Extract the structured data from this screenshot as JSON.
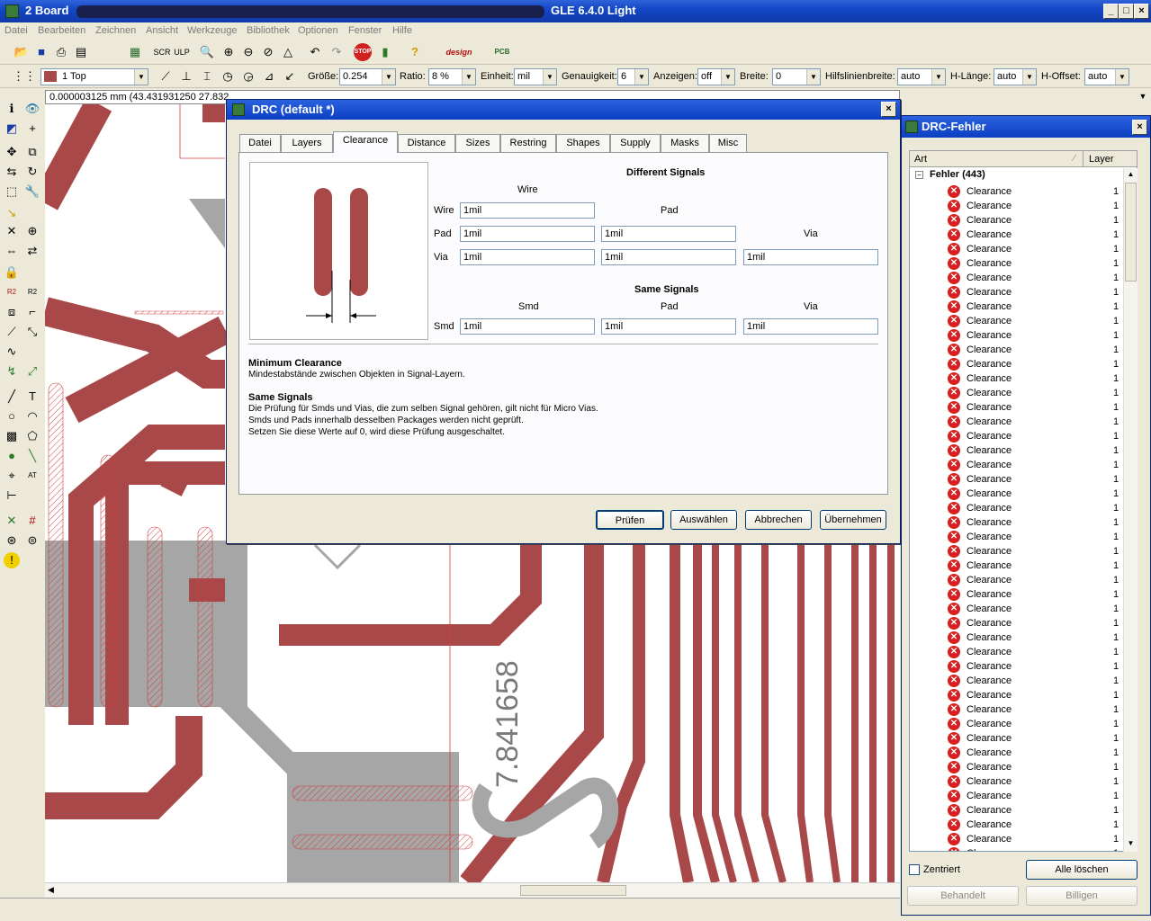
{
  "window": {
    "title": "2 Board",
    "title_suffix": "GLE 6.4.0 Light",
    "min": "_",
    "max": "□",
    "close": "×"
  },
  "menu": [
    "Datei",
    "Bearbeiten",
    "Zeichnen",
    "Ansicht",
    "Werkzeuge",
    "Bibliothek",
    "Optionen",
    "Fenster",
    "Hilfe"
  ],
  "toolbar2": {
    "layer": "1 Top",
    "groesse_label": "Größe:",
    "groesse": "0.254",
    "ratio_label": "Ratio:",
    "ratio": "8 %",
    "einheit_label": "Einheit:",
    "einheit": "mil",
    "genauigkeit_label": "Genauigkeit:",
    "genauigkeit": "6",
    "anzeigen_label": "Anzeigen:",
    "anzeigen": "off",
    "breite_label": "Breite:",
    "breite": "0",
    "hilfsbreite_label": "Hilfslinienbreite:",
    "hilfsbreite": "auto",
    "hlaenge_label": "H-Länge:",
    "hlaenge": "auto",
    "hoffset_label": "H-Offset:",
    "hoffset": "auto"
  },
  "coord": "0.000003125 mm (43.431931250 27.832",
  "canvas_text": "7.841658",
  "drc": {
    "title": "DRC (default *)",
    "close": "×",
    "tabs": [
      "Datei",
      "Layers",
      "Clearance",
      "Distance",
      "Sizes",
      "Restring",
      "Shapes",
      "Supply",
      "Masks",
      "Misc"
    ],
    "active_tab": "Clearance",
    "different_signals": "Different Signals",
    "same_signals": "Same Signals",
    "col_wire": "Wire",
    "col_pad": "Pad",
    "col_via": "Via",
    "col_smd": "Smd",
    "row_wire": "Wire",
    "row_pad": "Pad",
    "row_via": "Via",
    "row_smd": "Smd",
    "v_wire_wire": "1mil",
    "v_pad_wire": "1mil",
    "v_pad_pad": "1mil",
    "v_via_wire": "1mil",
    "v_via_pad": "1mil",
    "v_via_via": "1mil",
    "v_smd_smd": "1mil",
    "v_smd_pad": "1mil",
    "v_smd_via": "1mil",
    "help_title1": "Minimum Clearance",
    "help_text1": "Mindestabstände zwischen Objekten in Signal-Layern.",
    "help_title2": "Same Signals",
    "help_text2a": "Die Prüfung für Smds und Vias, die zum selben Signal gehören, gilt nicht für Micro Vias.",
    "help_text2b": "Smds und Pads innerhalb desselben Packages werden nicht geprüft.",
    "help_text2c": "Setzen Sie diese Werte auf 0, wird diese Prüfung ausgeschaltet.",
    "btn_check": "Prüfen",
    "btn_select": "Auswählen",
    "btn_cancel": "Abbrechen",
    "btn_apply": "Übernehmen"
  },
  "drcerr": {
    "title": "DRC-Fehler",
    "close": "×",
    "col_art": "Art",
    "col_layer": "Layer",
    "root": "Fehler (443)",
    "item_label": "Clearance",
    "item_layer": "1",
    "last_item": "Clearance",
    "zentriert": "Zentriert",
    "btn_clear": "Alle löschen",
    "btn_handled": "Behandelt",
    "btn_approve": "Billigen"
  },
  "colors": {
    "trace": "#a84848",
    "gray": "#a6a6a6",
    "titlebar": "#0c3fc2"
  }
}
